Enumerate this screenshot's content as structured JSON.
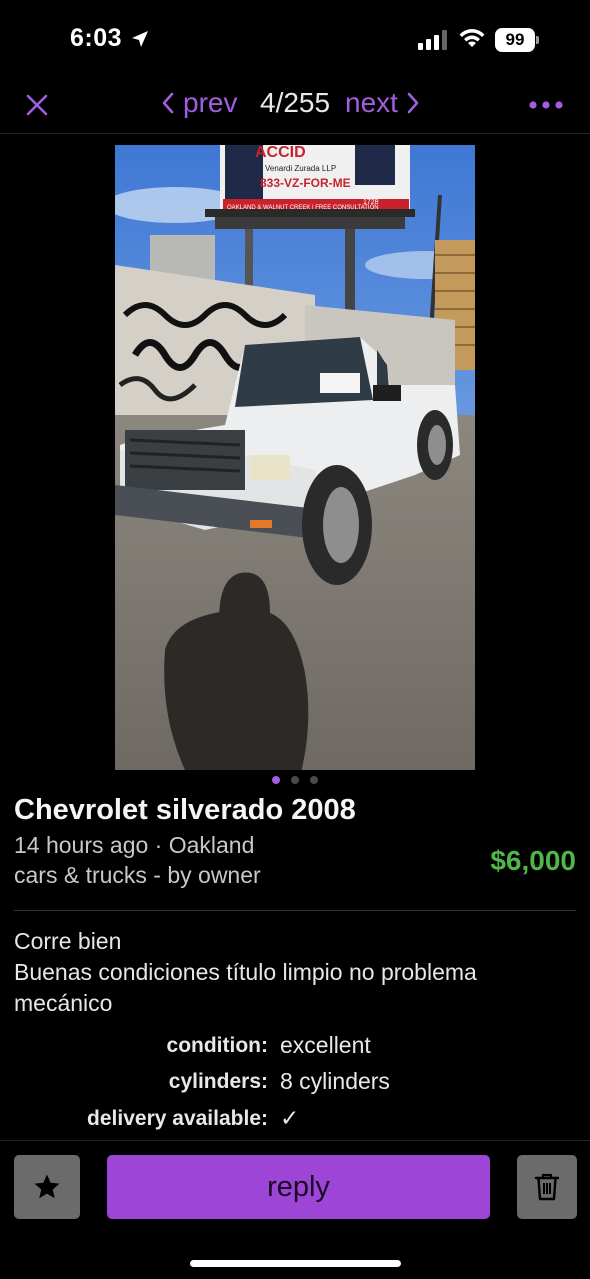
{
  "status_bar": {
    "time": "6:03",
    "battery": "99"
  },
  "nav": {
    "prev_label": "prev",
    "counter": "4/255",
    "next_label": "next"
  },
  "gallery": {
    "dot_count": 3,
    "active_index": 0
  },
  "photo": {
    "billboard_line1": "ACCID",
    "billboard_line2": "Venardi Zurada LLP",
    "billboard_line3": "833-VZ-FOR-ME",
    "billboard_line4": "OAKLAND & WALNUT CREEK | FREE CONSULTATION",
    "billboard_num": "1728"
  },
  "listing": {
    "title": "Chevrolet silverado 2008",
    "posted": "14 hours ago · Oakland",
    "category": "cars & trucks - by owner",
    "price": "$6,000",
    "description_line1": "Corre bien",
    "description_line2": "Buenas condiciones título limpio no problema mecánico"
  },
  "attributes": [
    {
      "label": "condition:",
      "value": "excellent"
    },
    {
      "label": "cylinders:",
      "value": "8 cylinders"
    },
    {
      "label": "delivery available:",
      "value": "✓"
    }
  ],
  "actions": {
    "reply_label": "reply"
  },
  "colors": {
    "accent": "#a35de0",
    "price": "#4fb64a",
    "reply_button": "#9d45d6",
    "icon_button": "#6b6b6b"
  }
}
